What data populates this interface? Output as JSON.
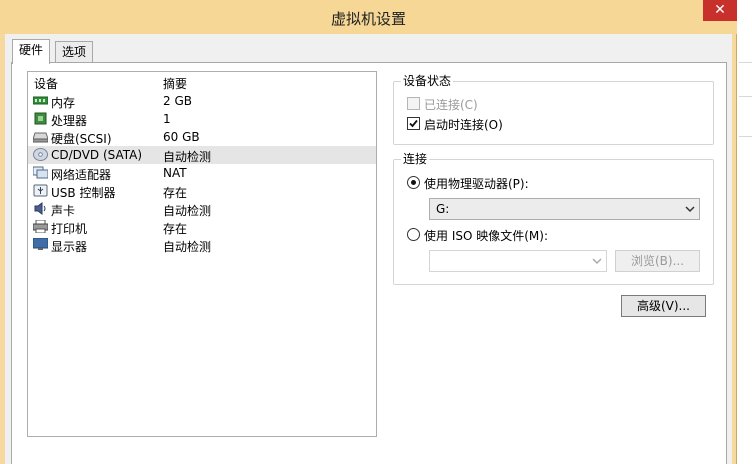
{
  "window": {
    "title": "虚拟机设置",
    "close_glyph": "✕"
  },
  "tabs": [
    {
      "label": "硬件",
      "active": true
    },
    {
      "label": "选项",
      "active": false
    }
  ],
  "device_list": {
    "columns": {
      "device": "设备",
      "summary": "摘要"
    },
    "rows": [
      {
        "icon": "memory-icon",
        "name": "内存",
        "summary": "2 GB"
      },
      {
        "icon": "processor-icon",
        "name": "处理器",
        "summary": "1"
      },
      {
        "icon": "hard-disk-icon",
        "name": "硬盘(SCSI)",
        "summary": "60 GB"
      },
      {
        "icon": "cd-dvd-icon",
        "name": "CD/DVD (SATA)",
        "summary": "自动检测",
        "selected": true
      },
      {
        "icon": "network-adapter-icon",
        "name": "网络适配器",
        "summary": "NAT"
      },
      {
        "icon": "usb-icon",
        "name": "USB 控制器",
        "summary": "存在"
      },
      {
        "icon": "sound-card-icon",
        "name": "声卡",
        "summary": "自动检测"
      },
      {
        "icon": "printer-icon",
        "name": "打印机",
        "summary": "存在"
      },
      {
        "icon": "display-icon",
        "name": "显示器",
        "summary": "自动检测"
      }
    ]
  },
  "device_status": {
    "legend": "设备状态",
    "connected": {
      "label": "已连接(C)",
      "checked": false,
      "disabled": true
    },
    "connect_at_power_on": {
      "label": "启动时连接(O)",
      "checked": true
    }
  },
  "connection": {
    "legend": "连接",
    "physical_drive": {
      "label": "使用物理驱动器(P):",
      "selected": true,
      "value": "G:"
    },
    "iso_image": {
      "label": "使用 ISO 映像文件(M):",
      "selected": false,
      "value": ""
    },
    "browse_label": "浏览(B)..."
  },
  "advanced_label": "高级(V)...",
  "colors": {
    "title_bar": "#f6d796",
    "close_button": "#c7302b",
    "selected_row": "#e5e5e5"
  }
}
